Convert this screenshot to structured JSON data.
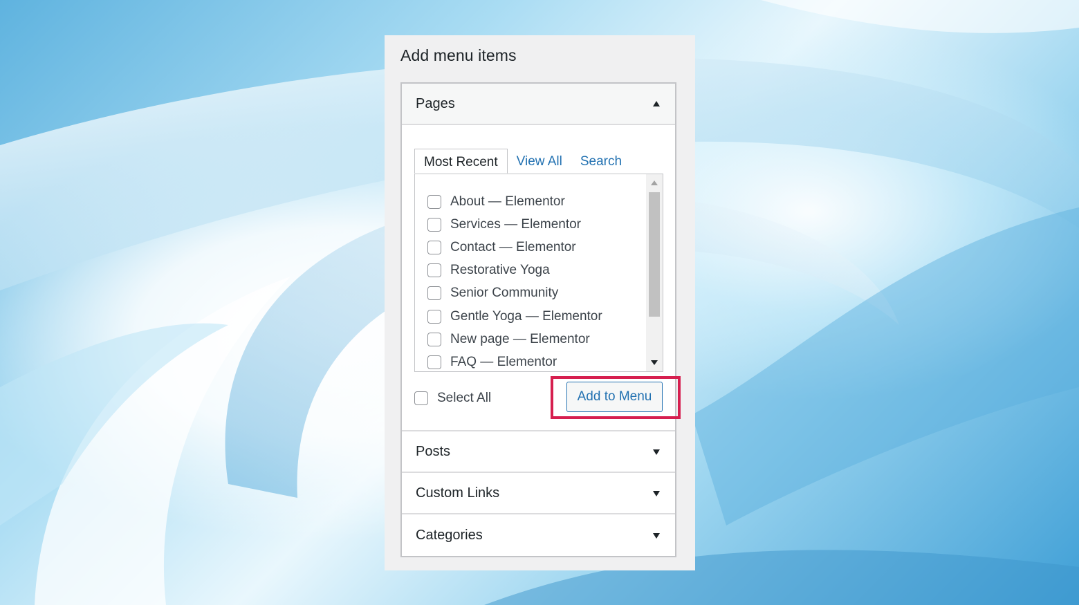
{
  "panel": {
    "title": "Add menu items"
  },
  "sections": {
    "pages": {
      "label": "Pages",
      "tabs": [
        {
          "label": "Most Recent",
          "active": true
        },
        {
          "label": "View All",
          "active": false
        },
        {
          "label": "Search",
          "active": false
        }
      ],
      "items": [
        {
          "label": "About — Elementor",
          "checked": false
        },
        {
          "label": "Services — Elementor",
          "checked": false
        },
        {
          "label": "Contact — Elementor",
          "checked": false
        },
        {
          "label": "Restorative Yoga",
          "checked": false
        },
        {
          "label": "Senior Community",
          "checked": false
        },
        {
          "label": "Gentle Yoga — Elementor",
          "checked": false
        },
        {
          "label": "New page — Elementor",
          "checked": false
        },
        {
          "label": "FAQ — Elementor",
          "checked": false
        }
      ],
      "select_all_label": "Select All",
      "add_button_label": "Add to Menu"
    },
    "posts": {
      "label": "Posts"
    },
    "custom_links": {
      "label": "Custom Links"
    },
    "categories": {
      "label": "Categories"
    }
  },
  "icons": {
    "expanded": "chevron-up-icon",
    "collapsed": "chevron-down-icon"
  },
  "colors": {
    "link": "#2271b1",
    "highlight": "#d61f4f",
    "panel_bg": "#f0f0f1"
  }
}
